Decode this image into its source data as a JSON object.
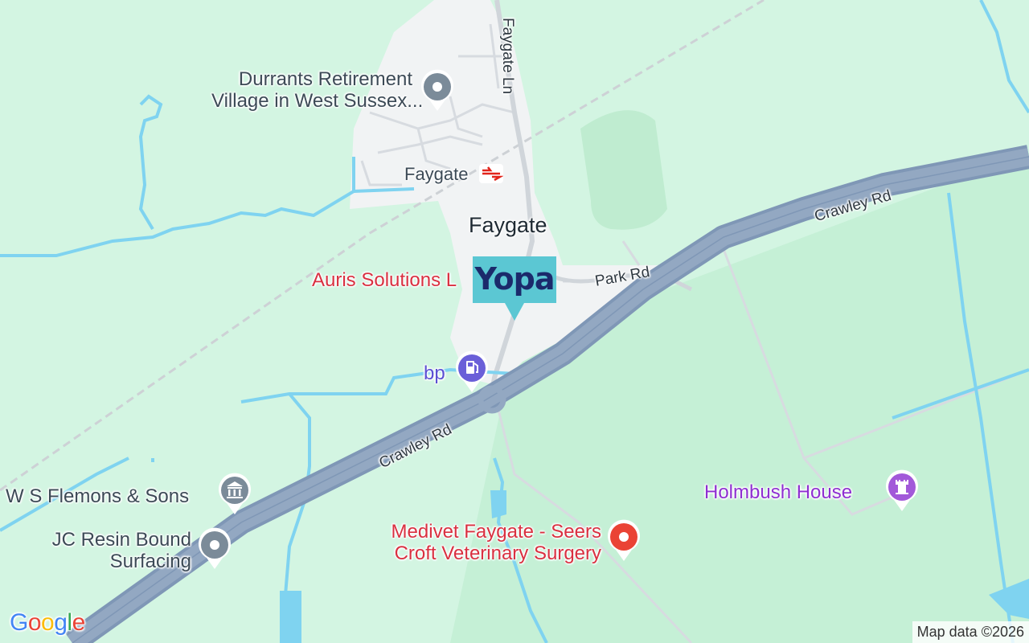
{
  "map": {
    "place_label": "Faygate",
    "station_label": "Faygate",
    "roads": {
      "faygate_ln": "Faygate Ln",
      "park_rd": "Park Rd",
      "crawley_rd_east": "Crawley Rd",
      "crawley_rd_west": "Crawley Rd"
    },
    "pois": {
      "durrants_line1": "Durrants Retirement",
      "durrants_line2": "Village in West Sussex...",
      "auris": "Auris Solutions L",
      "bp": "bp",
      "flemons": "W S Flemons & Sons",
      "jc_line1": "JC Resin Bound",
      "jc_line2": "Surfacing",
      "medivet_line1": "Medivet Faygate - Seers",
      "medivet_line2": "Croft Veterinary Surgery",
      "holmbush": "Holmbush House"
    },
    "brand_marker": "Yopa",
    "logo": [
      "G",
      "o",
      "o",
      "g",
      "l",
      "e"
    ],
    "attribution": "Map data ©2026"
  },
  "colors": {
    "land": "#d3f5e2",
    "settlement": "#f1f3f4",
    "motorway": "#8fa4bf",
    "water": "#7fd3f0",
    "red_poi": "#d93040",
    "purple_poi": "#8e2fd1",
    "grey_pin": "#7b8b99",
    "brand": "#5bc7d3"
  },
  "icons": {
    "generic": "pin-icon",
    "rail": "national-rail-icon",
    "fuel": "fuel-pump-icon",
    "museum": "museum-icon",
    "vet": "medical-dot-icon",
    "castle": "castle-icon"
  }
}
